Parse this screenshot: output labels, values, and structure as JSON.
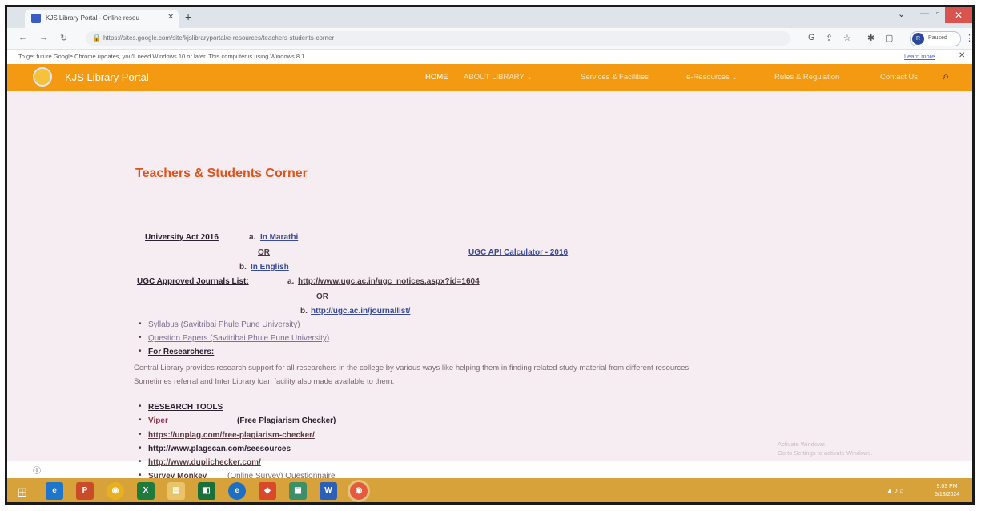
{
  "browser": {
    "tab_title": "KJS Library Portal - Online resou",
    "url": "https://sites.google.com/site/kjslibraryportal/e-resources/teachers-students-corner",
    "profile_initial": "R",
    "profile_label": "Paused",
    "info_message": "To get future Google Chrome updates, you'll need Windows 10 or later. This computer is using Windows 8.1.",
    "learn_more": "Learn more"
  },
  "site": {
    "name": "KJS Library Portal",
    "nav": {
      "home": "HOME",
      "about": "ABOUT LIBRARY",
      "services": "Services & Facilities",
      "eresources": "e-Resources",
      "rules": "Rules & Regulation",
      "contact": "Contact Us"
    }
  },
  "page": {
    "title": "Teachers & Students Corner",
    "university_act": "University Act 2016",
    "marathi_prefix": "a.",
    "marathi_link": "In Marathi",
    "or1": "OR",
    "english_prefix": "b.",
    "english_link": "In English",
    "ugc_api": "UGC API Calculator - 2016",
    "ugc_journals": "UGC Approved Journals List:",
    "ugc_a_prefix": "a.",
    "ugc_link_a": "http://www.ugc.ac.in/ugc_notices.aspx?id=1604",
    "or2": "OR",
    "ugc_b_prefix": "b.",
    "ugc_link_b": "http://ugc.ac.in/journallist/",
    "syllabus": "Syllabus (Savitribai Phule Pune University)",
    "question_papers": "Question Papers (Savitribai Phule Pune University)",
    "for_researchers": "For Researchers:",
    "research_para": "Central Library provides research support for all researchers in the college by various ways like helping them in finding related study material from different resources. Sometimes referral and Inter Library loan facility also made available to them.",
    "research_tools": "RESEARCH TOOLS",
    "viper": "Viper",
    "viper_note": "(Free Plagiarism Checker)",
    "unplag": "https://unplag.com/free-plagiarism-checker/",
    "plagscan": "http://www.plagscan.com/seesources",
    "duplichecker": "http://www.duplichecker.com/",
    "survey_monkey": "Survey Monkey",
    "survey_note": "(Online Survey) Questionnaire",
    "watermark_line1": "Activate Windows",
    "watermark_line2": "Go to Settings to activate Windows."
  },
  "taskbar": {
    "time": "9:03 PM",
    "date": "6/18/2024",
    "apps": [
      "ie-icon",
      "powerpoint-icon",
      "chrome-icon",
      "excel-icon",
      "file-explorer-icon",
      "store-icon",
      "edge-icon",
      "anydesk-icon",
      "image-viewer-icon",
      "word-icon",
      "chrome-active-icon"
    ]
  },
  "colors": {
    "site_nav": "#f39a12",
    "title_orange": "#e0541b",
    "content_bg": "#f6edf2",
    "taskbar": "#d7a23a"
  }
}
